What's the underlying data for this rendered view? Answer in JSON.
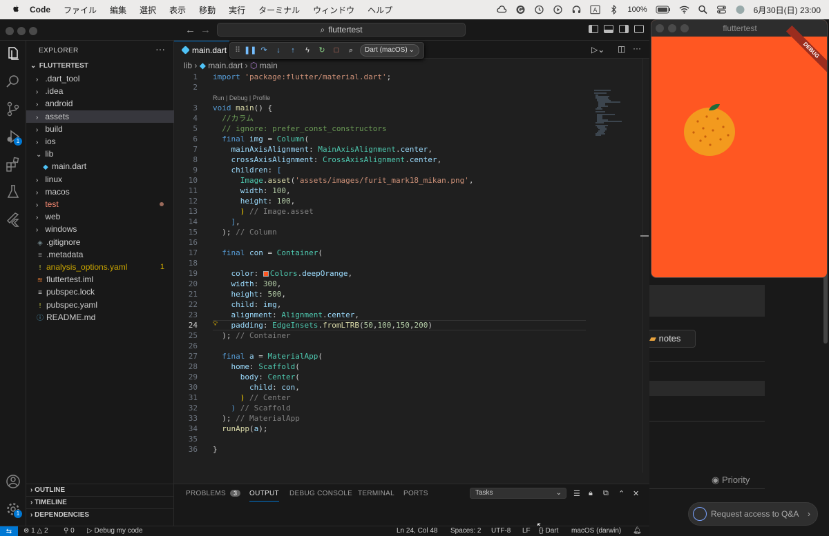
{
  "menubar": {
    "app": "Code",
    "items": [
      "ファイル",
      "編集",
      "選択",
      "表示",
      "移動",
      "実行",
      "ターミナル",
      "ウィンドウ",
      "ヘルプ"
    ],
    "battery": "100%",
    "clock": "6月30日(日)  23:00"
  },
  "titlebar": {
    "search": "fluttertest"
  },
  "activity": {
    "run_badge": "1",
    "settings_badge": "1"
  },
  "explorer": {
    "title": "EXPLORER",
    "root": "FLUTTERTEST",
    "items": [
      {
        "label": ".dart_tool",
        "kind": "folder",
        "indent": 1,
        "open": false
      },
      {
        "label": ".idea",
        "kind": "folder",
        "indent": 1,
        "open": false
      },
      {
        "label": "android",
        "kind": "folder",
        "indent": 1,
        "open": false
      },
      {
        "label": "assets",
        "kind": "folder",
        "indent": 1,
        "open": false,
        "selected": true
      },
      {
        "label": "build",
        "kind": "folder",
        "indent": 1,
        "open": false
      },
      {
        "label": "ios",
        "kind": "folder",
        "indent": 1,
        "open": false
      },
      {
        "label": "lib",
        "kind": "folder",
        "indent": 1,
        "open": true
      },
      {
        "label": "main.dart",
        "kind": "dart",
        "indent": 2
      },
      {
        "label": "linux",
        "kind": "folder",
        "indent": 1,
        "open": false
      },
      {
        "label": "macos",
        "kind": "folder",
        "indent": 1,
        "open": false
      },
      {
        "label": "test",
        "kind": "folder",
        "indent": 1,
        "open": false,
        "color": "#f48771",
        "dot": true
      },
      {
        "label": "web",
        "kind": "folder",
        "indent": 1,
        "open": false
      },
      {
        "label": "windows",
        "kind": "folder",
        "indent": 1,
        "open": false
      },
      {
        "label": ".gitignore",
        "kind": "git",
        "indent": 1
      },
      {
        "label": ".metadata",
        "kind": "meta",
        "indent": 1
      },
      {
        "label": "analysis_options.yaml",
        "kind": "yaml",
        "indent": 1,
        "color": "#cca700",
        "mark": "1"
      },
      {
        "label": "fluttertest.iml",
        "kind": "rss",
        "indent": 1
      },
      {
        "label": "pubspec.lock",
        "kind": "lock",
        "indent": 1
      },
      {
        "label": "pubspec.yaml",
        "kind": "yaml",
        "indent": 1
      },
      {
        "label": "README.md",
        "kind": "info",
        "indent": 1
      }
    ],
    "sections": [
      "OUTLINE",
      "TIMELINE",
      "DEPENDENCIES"
    ]
  },
  "editor": {
    "tab": "main.dart",
    "debug_target": "Dart (macOS)",
    "crumbs": [
      "lib",
      "main.dart",
      "main"
    ],
    "codelens": "Run | Debug | Profile",
    "cursor_line": 24,
    "lines": [
      [
        [
          "k",
          "import "
        ],
        [
          "s",
          "'package:flutter/material.dart'"
        ],
        [
          "",
          "; "
        ]
      ],
      [],
      [
        [
          "k",
          "void "
        ],
        [
          "f",
          "main"
        ],
        [
          "",
          "() {"
        ]
      ],
      [
        [
          "",
          "  "
        ],
        [
          "c",
          "//カラム"
        ]
      ],
      [
        [
          "",
          "  "
        ],
        [
          "c",
          "// ignore: prefer_const_constructors"
        ]
      ],
      [
        [
          "",
          "  "
        ],
        [
          "k",
          "final "
        ],
        [
          "p",
          "img"
        ],
        [
          "",
          " = "
        ],
        [
          "t",
          "Column"
        ],
        [
          "",
          "("
        ]
      ],
      [
        [
          "",
          "    "
        ],
        [
          "p",
          "mainAxisAlignment"
        ],
        [
          "",
          ": "
        ],
        [
          "t",
          "MainAxisAlignment"
        ],
        [
          "",
          "."
        ],
        [
          "p",
          "center"
        ],
        [
          "",
          ","
        ]
      ],
      [
        [
          "",
          "    "
        ],
        [
          "p",
          "crossAxisAlignment"
        ],
        [
          "",
          ": "
        ],
        [
          "t",
          "CrossAxisAlignment"
        ],
        [
          "",
          "."
        ],
        [
          "p",
          "center"
        ],
        [
          "",
          ","
        ]
      ],
      [
        [
          "",
          "    "
        ],
        [
          "p",
          "children"
        ],
        [
          "",
          ": "
        ],
        [
          "k",
          "["
        ]
      ],
      [
        [
          "",
          "      "
        ],
        [
          "t",
          "Image"
        ],
        [
          "",
          "."
        ],
        [
          "f",
          "asset"
        ],
        [
          "",
          "("
        ],
        [
          "s",
          "'assets/images/furit_mark18_mikan.png'"
        ],
        [
          "",
          ","
        ]
      ],
      [
        [
          "",
          "      "
        ],
        [
          "p",
          "width"
        ],
        [
          "",
          ": "
        ],
        [
          "n",
          "100"
        ],
        [
          "",
          ","
        ]
      ],
      [
        [
          "",
          "      "
        ],
        [
          "p",
          "height"
        ],
        [
          "",
          ": "
        ],
        [
          "n",
          "100"
        ],
        [
          "",
          ","
        ]
      ],
      [
        [
          "",
          "      "
        ],
        [
          "y",
          ")"
        ],
        [
          "g",
          " // Image.asset"
        ]
      ],
      [
        [
          "",
          "    "
        ],
        [
          "k",
          "]"
        ],
        [
          "",
          ","
        ]
      ],
      [
        [
          "",
          "  "
        ],
        [
          "",
          "); "
        ],
        [
          "g",
          "// Column"
        ]
      ],
      [],
      [
        [
          "",
          "  "
        ],
        [
          "k",
          "final "
        ],
        [
          "p",
          "con"
        ],
        [
          "",
          " = "
        ],
        [
          "t",
          "Container"
        ],
        [
          "",
          "("
        ]
      ],
      [],
      [
        [
          "",
          "    "
        ],
        [
          "p",
          "color"
        ],
        [
          "",
          ": "
        ],
        [
          "sw",
          ""
        ],
        [
          "t",
          "Colors"
        ],
        [
          "",
          "."
        ],
        [
          "p",
          "deepOrange"
        ],
        [
          "",
          ","
        ]
      ],
      [
        [
          "",
          "    "
        ],
        [
          "p",
          "width"
        ],
        [
          "",
          ": "
        ],
        [
          "n",
          "300"
        ],
        [
          "",
          ","
        ]
      ],
      [
        [
          "",
          "    "
        ],
        [
          "p",
          "height"
        ],
        [
          "",
          ": "
        ],
        [
          "n",
          "500"
        ],
        [
          "",
          ","
        ]
      ],
      [
        [
          "",
          "    "
        ],
        [
          "p",
          "child"
        ],
        [
          "",
          ": "
        ],
        [
          "p",
          "img"
        ],
        [
          "",
          ","
        ]
      ],
      [
        [
          "",
          "    "
        ],
        [
          "p",
          "alignment"
        ],
        [
          "",
          ": "
        ],
        [
          "t",
          "Alignment"
        ],
        [
          "",
          "."
        ],
        [
          "p",
          "center"
        ],
        [
          "",
          ","
        ]
      ],
      [
        [
          "",
          "    "
        ],
        [
          "p",
          "padding"
        ],
        [
          "",
          ": "
        ],
        [
          "t",
          "EdgeInsets"
        ],
        [
          "",
          "."
        ],
        [
          "f",
          "fromLTRB"
        ],
        [
          "",
          "("
        ],
        [
          "n",
          "50"
        ],
        [
          "",
          ","
        ],
        [
          "n",
          "100"
        ],
        [
          "",
          ","
        ],
        [
          "n",
          "150"
        ],
        [
          "",
          ","
        ],
        [
          "n",
          "200"
        ],
        [
          "",
          ")"
        ]
      ],
      [
        [
          "",
          "  "
        ],
        [
          "",
          "); "
        ],
        [
          "g",
          "// Container"
        ]
      ],
      [],
      [
        [
          "",
          "  "
        ],
        [
          "k",
          "final "
        ],
        [
          "p",
          "a"
        ],
        [
          "",
          " = "
        ],
        [
          "t",
          "MaterialApp"
        ],
        [
          "",
          "("
        ]
      ],
      [
        [
          "",
          "    "
        ],
        [
          "p",
          "home"
        ],
        [
          "",
          ": "
        ],
        [
          "t",
          "Scaffold"
        ],
        [
          "",
          "("
        ]
      ],
      [
        [
          "",
          "      "
        ],
        [
          "p",
          "body"
        ],
        [
          "",
          ": "
        ],
        [
          "t",
          "Center"
        ],
        [
          "",
          "("
        ]
      ],
      [
        [
          "",
          "        "
        ],
        [
          "p",
          "child"
        ],
        [
          "",
          ": "
        ],
        [
          "p",
          "con"
        ],
        [
          "",
          ","
        ]
      ],
      [
        [
          "",
          "      "
        ],
        [
          "y",
          ")"
        ],
        [
          "g",
          " // Center"
        ]
      ],
      [
        [
          "",
          "    "
        ],
        [
          "k",
          ")"
        ],
        [
          "g",
          " // Scaffold"
        ]
      ],
      [
        [
          "",
          "  "
        ],
        [
          "",
          "); "
        ],
        [
          "g",
          "// MaterialApp"
        ]
      ],
      [
        [
          "",
          "  "
        ],
        [
          "f",
          "runApp"
        ],
        [
          "",
          "("
        ],
        [
          "p",
          "a"
        ],
        [
          "",
          ");"
        ]
      ],
      [],
      [
        [
          "",
          "}"
        ]
      ]
    ]
  },
  "panel": {
    "tabs": [
      "PROBLEMS",
      "OUTPUT",
      "DEBUG CONSOLE",
      "TERMINAL",
      "PORTS"
    ],
    "problems_count": "3",
    "active": "OUTPUT",
    "task_select": "Tasks"
  },
  "statusbar": {
    "errors": "1",
    "warnings": "2",
    "ports": "0",
    "debug": "Debug my code",
    "position": "Ln 24, Col 48",
    "spaces": "Spaces: 2",
    "encoding": "UTF-8",
    "eol": "LF",
    "language": "Dart",
    "device": "macOS (darwin)"
  },
  "flutter": {
    "title": "fluttertest",
    "banner": "DEBUG",
    "background": "#ff5722"
  },
  "web": {
    "notes": "notes",
    "priority": "Priority",
    "qa": "Request access to Q&A"
  }
}
